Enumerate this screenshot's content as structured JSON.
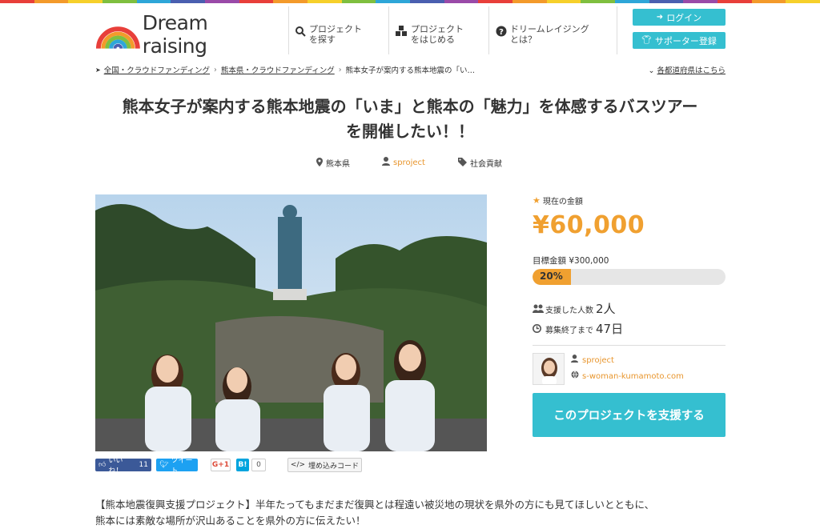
{
  "colors": {
    "accent": "#35bfd0",
    "amount": "#f0a030",
    "author": "#e8962e",
    "rainbow": [
      "#e83f3a",
      "#f39a2b",
      "#f6d02b",
      "#7fbf3f",
      "#2ea6d8",
      "#4a5fb0",
      "#9a4aa8",
      "#e83f3a",
      "#f39a2b",
      "#f6d02b",
      "#7fbf3f",
      "#2ea6d8",
      "#4a5fb0",
      "#9a4aa8",
      "#e83f3a",
      "#f39a2b",
      "#f6d02b",
      "#7fbf3f",
      "#2ea6d8",
      "#4a5fb0",
      "#9a4aa8",
      "#e83f3a",
      "#f39a2b",
      "#f6d02b"
    ]
  },
  "header": {
    "logo_text": "Dream raising",
    "nav": [
      {
        "icon": "search-icon",
        "line1": "プロジェクト",
        "line2": "を探す"
      },
      {
        "icon": "cubes-icon",
        "line1": "プロジェクト",
        "line2": "をはじめる"
      },
      {
        "icon": "question-icon",
        "line1": "ドリームレイジング",
        "line2": "とは？"
      }
    ],
    "login_label": "ログイン",
    "signup_label": "サポーター登録"
  },
  "breadcrumb": {
    "items": [
      "全国・クラウドファンディング",
      "熊本県・クラウドファンディング"
    ],
    "current": "熊本女子が案内する熊本地震の「い…",
    "region_link": "各都道府県はこちら"
  },
  "project": {
    "title_line1": "熊本女子が案内する熊本地震の「いま」と熊本の「魅力」を体感するバスツアー",
    "title_line2": "を開催したい！！",
    "location": "熊本県",
    "author": "sproject",
    "category": "社会貢献",
    "image_icon": "hero-photo-icon"
  },
  "social": {
    "fb_label": "いいね！",
    "fb_count": "11",
    "tw_label": "ツイート",
    "gp_label": "G+1",
    "hb_label": "B!",
    "hb_count": "0",
    "embed_label": "埋め込みコード"
  },
  "funding": {
    "current_label": "現在の金額",
    "current_amount": "¥60,000",
    "goal_label": "目標金額 ¥300,000",
    "progress_percent": 20,
    "progress_text": "20%",
    "supporters_label": "支援した人数",
    "supporters_value": "2人",
    "deadline_label": "募集終了まで",
    "deadline_value": "47日",
    "owner_name": "sproject",
    "owner_site": "s-woman-kumamoto.com",
    "support_button": "このプロジェクトを支援する"
  },
  "intro": {
    "line1": "【熊本地震復興支援プロジェクト】半年たってもまだまだ復興とは程遠い被災地の現状を県外の方にも見てほしいとともに、",
    "line2": "熊本には素敵な場所が沢山あることを県外の方に伝えたい！"
  }
}
